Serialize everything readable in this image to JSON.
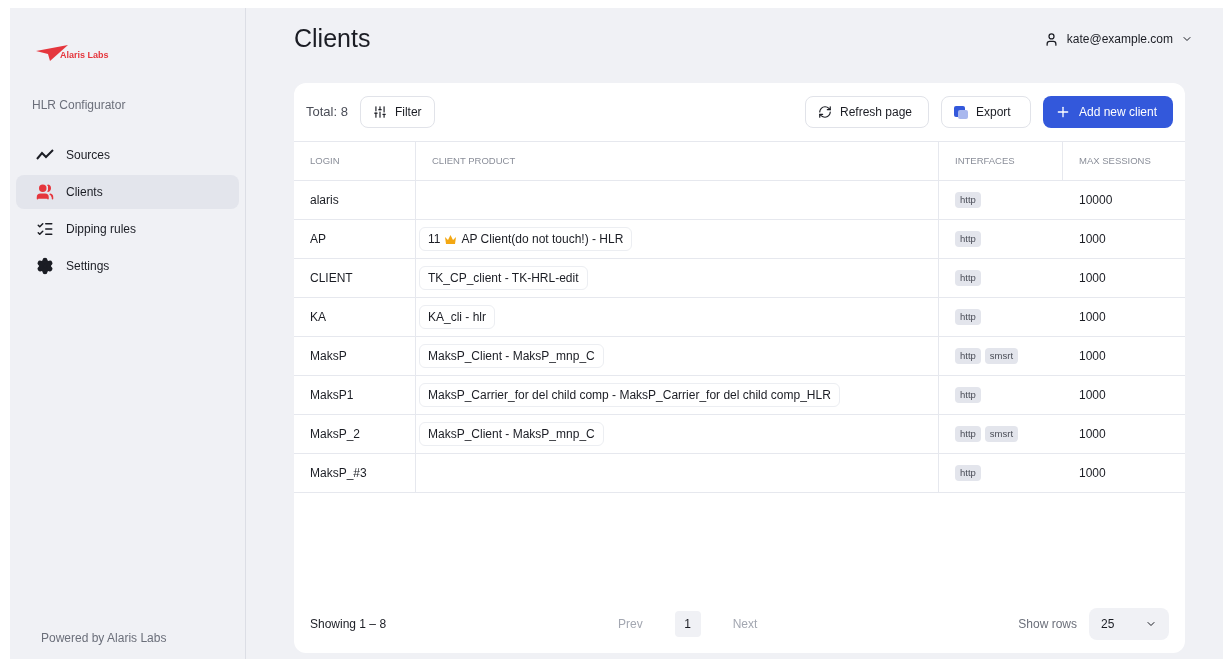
{
  "logo": {
    "text": "Alaris Labs"
  },
  "app_title": "HLR Configurator",
  "sidebar": {
    "items": [
      {
        "label": "Sources",
        "selected": false
      },
      {
        "label": "Clients",
        "selected": true
      },
      {
        "label": "Dipping rules",
        "selected": false
      },
      {
        "label": "Settings",
        "selected": false
      }
    ]
  },
  "footer": "Powered by Alaris Labs",
  "page_title": "Clients",
  "user": {
    "email": "kate@example.com"
  },
  "toolbar": {
    "total": "Total: 8",
    "filter": "Filter",
    "refresh": "Refresh page",
    "export": "Export",
    "add": "Add new client"
  },
  "table": {
    "columns": [
      "LOGIN",
      "CLIENT PRODUCT",
      "INTERFACES",
      "MAX SESSIONS"
    ],
    "rows": [
      {
        "login": "alaris",
        "interfaces": [
          "http"
        ],
        "max_sessions": "10000"
      },
      {
        "login": "AP",
        "product": {
          "prefix": "11",
          "crown": true,
          "text": "AP Client(do not touch!) - HLR"
        },
        "interfaces": [
          "http"
        ],
        "max_sessions": "1000"
      },
      {
        "login": "CLIENT",
        "product": {
          "text": "TK_CP_client - TK-HRL-edit"
        },
        "interfaces": [
          "http"
        ],
        "max_sessions": "1000"
      },
      {
        "login": "KA",
        "product": {
          "text": "KA_cli - hlr"
        },
        "interfaces": [
          "http"
        ],
        "max_sessions": "1000"
      },
      {
        "login": "MaksP",
        "product": {
          "text": "MaksP_Client - MaksP_mnp_C"
        },
        "interfaces": [
          "http",
          "smsrt"
        ],
        "max_sessions": "1000"
      },
      {
        "login": "MaksP1",
        "product": {
          "text": "MaksP_Carrier_for del child comp - MaksP_Carrier_for del child comp_HLR"
        },
        "interfaces": [
          "http"
        ],
        "max_sessions": "1000"
      },
      {
        "login": "MaksP_2",
        "product": {
          "text": "MaksP_Client - MaksP_mnp_C"
        },
        "interfaces": [
          "http",
          "smsrt"
        ],
        "max_sessions": "1000"
      },
      {
        "login": "MaksP_#3",
        "interfaces": [
          "http"
        ],
        "max_sessions": "1000"
      }
    ]
  },
  "pagination": {
    "showing": "Showing 1 – 8",
    "prev": "Prev",
    "pages": [
      {
        "label": "1",
        "selected": true
      }
    ],
    "next": "Next",
    "rows_label": "Show rows",
    "rows_value": "25"
  }
}
